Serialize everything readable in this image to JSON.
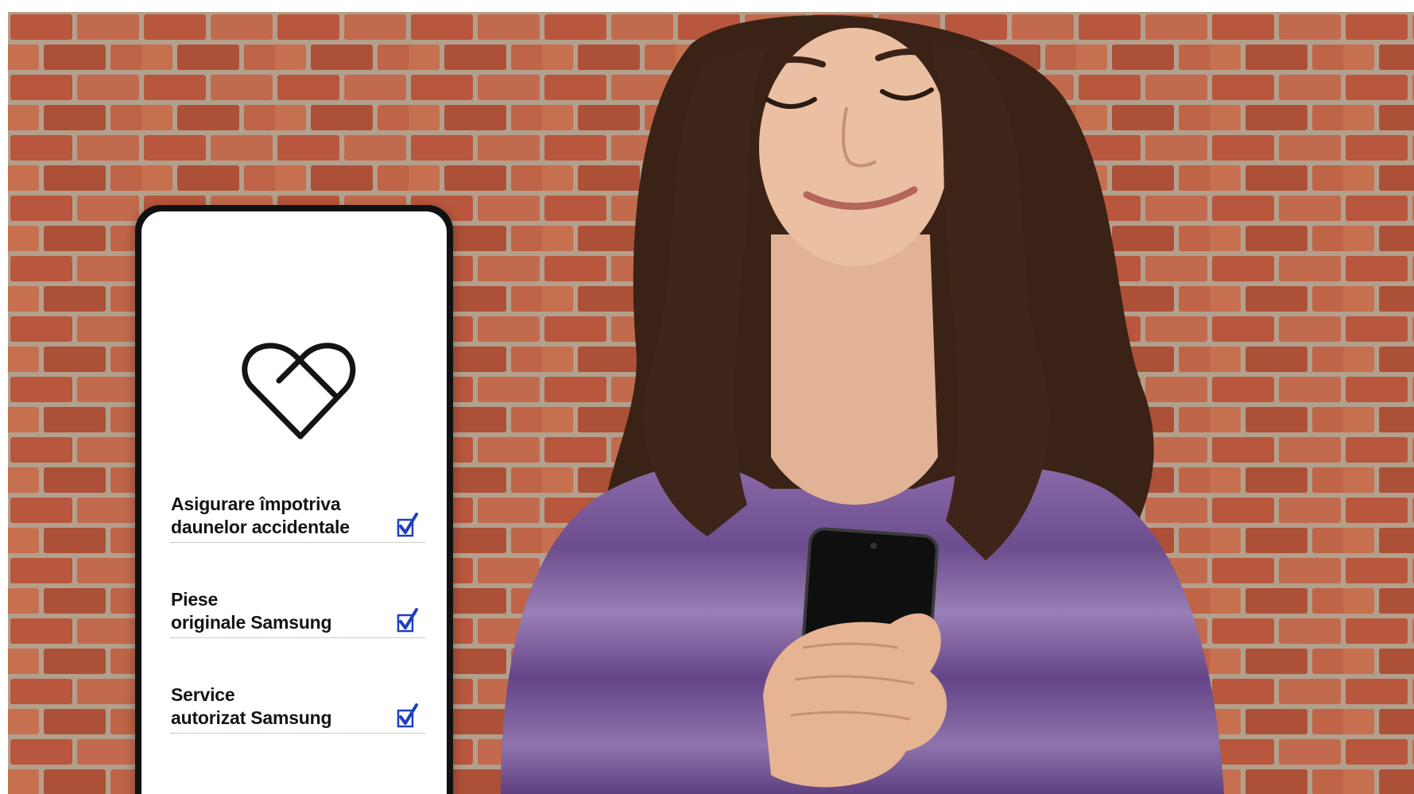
{
  "image": {
    "alt": "Femeie zâmbitoare cu ochii închiși ținând un telefon Samsung la piept, în fața unui zid de cărămidă"
  },
  "features": [
    {
      "line1": "Asigurare împotriva",
      "line2": "daunelor accidentale",
      "checked": true
    },
    {
      "line1": "Piese",
      "line2": "originale Samsung",
      "checked": true
    },
    {
      "line1": "Service",
      "line2": "autorizat Samsung",
      "checked": true
    }
  ],
  "icons": {
    "logo": "heart-shield-icon",
    "check": "checkbox-checked-icon"
  },
  "colors": {
    "brick": "#b5644a",
    "mortar": "#b7a592",
    "sweater": "#7b5c9a",
    "hair": "#3a2216",
    "check": "#1f3fbf"
  }
}
